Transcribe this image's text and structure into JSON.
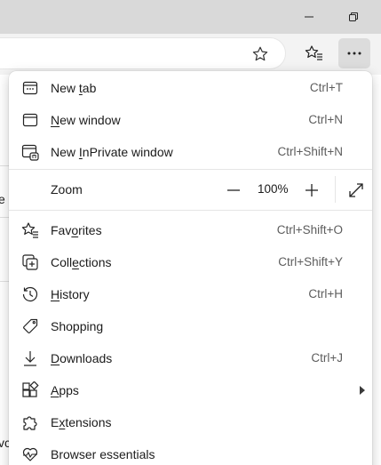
{
  "page": {
    "fragment_1": "e",
    "fragment_2": "vc"
  },
  "icons": {
    "minimize": "minimize-icon",
    "restore": "restore-window-icon",
    "star": "star-outline-icon",
    "favorites_bar": "favorites-star-list-icon",
    "more": "ellipsis-icon"
  },
  "menu": {
    "new_tab": {
      "label_pre": "New ",
      "label_key": "t",
      "label_post": "ab",
      "shortcut": "Ctrl+T"
    },
    "new_window": {
      "label_pre": "",
      "label_key": "N",
      "label_post": "ew window",
      "shortcut": "Ctrl+N"
    },
    "new_inprivate": {
      "label_pre": "New ",
      "label_key": "I",
      "label_post": "nPrivate window",
      "shortcut": "Ctrl+Shift+N"
    },
    "zoom": {
      "label": "Zoom",
      "value": "100%"
    },
    "favorites": {
      "label_pre": "Fav",
      "label_key": "o",
      "label_post": "rites",
      "shortcut": "Ctrl+Shift+O"
    },
    "collections": {
      "label_pre": "Coll",
      "label_key": "e",
      "label_post": "ctions",
      "shortcut": "Ctrl+Shift+Y"
    },
    "history": {
      "label_pre": "",
      "label_key": "H",
      "label_post": "istory",
      "shortcut": "Ctrl+H"
    },
    "shopping": {
      "label": "Shopping"
    },
    "downloads": {
      "label_pre": "",
      "label_key": "D",
      "label_post": "ownloads",
      "shortcut": "Ctrl+J"
    },
    "apps": {
      "label_pre": "",
      "label_key": "A",
      "label_post": "pps"
    },
    "extensions": {
      "label_pre": "E",
      "label_key": "x",
      "label_post": "tensions"
    },
    "browser_essentials": {
      "label": "Browser essentials"
    }
  }
}
